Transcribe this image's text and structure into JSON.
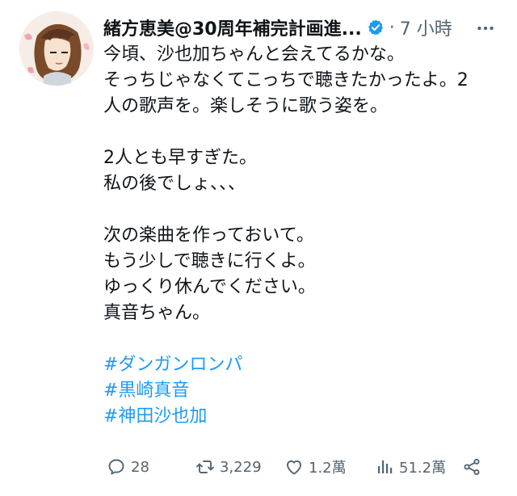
{
  "tweet": {
    "display_name": "緒方恵美@30周年補完計画進...",
    "separator": "·",
    "time": "7 小時",
    "lines": [
      "今頃、沙也加ちゃんと会えてるかな。",
      "そっちじゃなくてこっちで聴きたかったよ。2",
      "人の歌声を。楽しそうに歌う姿を。",
      "",
      "2人とも早すぎた。",
      "私の後でしょ、、、",
      "",
      "次の楽曲を作っておいて。",
      "もう少しで聴きに行くよ。",
      "ゆっくり休んでください。",
      "真音ちゃん。",
      ""
    ],
    "hashtags": [
      "#ダンガンロンパ",
      "#黒崎真音",
      "#神田沙也加"
    ]
  },
  "actions": {
    "reply_count": "28",
    "retweet_count": "3,229",
    "like_count": "1.2萬",
    "view_count": "51.2萬"
  },
  "icons": {
    "verified": "verified-badge-icon",
    "more": "more-icon",
    "reply": "reply-icon",
    "retweet": "retweet-icon",
    "like": "heart-icon",
    "views": "views-icon",
    "share": "share-icon"
  },
  "colors": {
    "text": "#0f1419",
    "secondary": "#536471",
    "accent": "#1d9bf0"
  }
}
